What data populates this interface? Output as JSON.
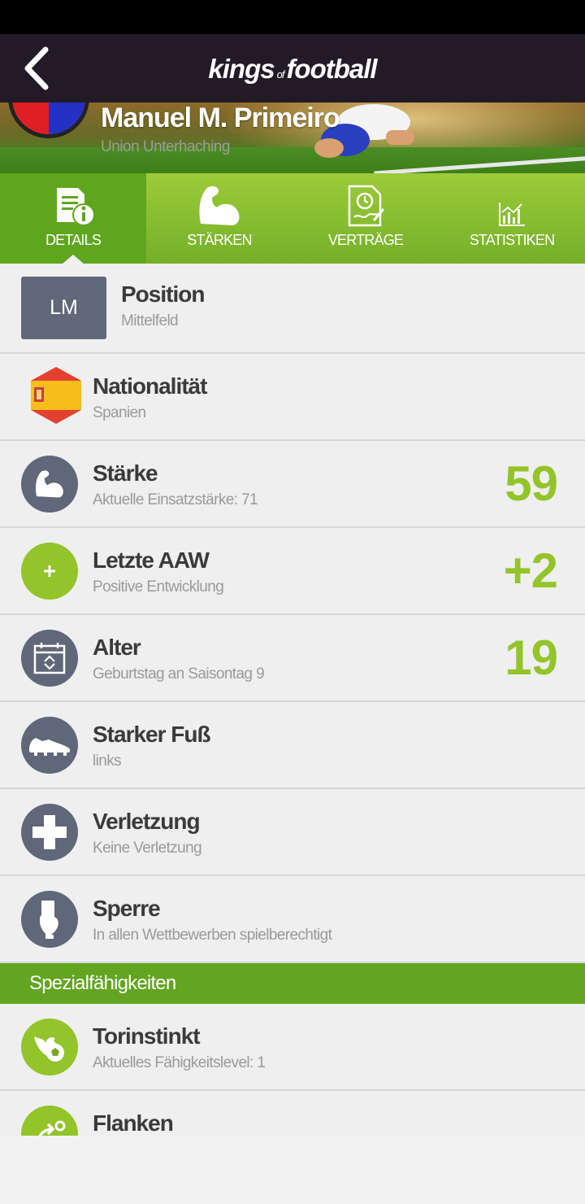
{
  "header": {
    "logo_part1": "kings",
    "logo_of": "of",
    "logo_part2": "football"
  },
  "player": {
    "name": "Manuel M. Primeiro",
    "club": "Union Unterhaching",
    "club_colors": [
      "#e01e26",
      "#2431c4"
    ]
  },
  "tabs": [
    {
      "label": "DETAILS",
      "icon": "details-icon",
      "active": true
    },
    {
      "label": "STÄRKEN",
      "icon": "muscle-icon",
      "active": false
    },
    {
      "label": "VERTRÄGE",
      "icon": "contract-icon",
      "active": false
    },
    {
      "label": "STATISTIKEN",
      "icon": "chart-icon",
      "active": false
    }
  ],
  "details": {
    "position": {
      "badge": "LM",
      "title": "Position",
      "subtitle": "Mittelfeld"
    },
    "nationality": {
      "title": "Nationalität",
      "subtitle": "Spanien",
      "icon": "spain-flag-icon"
    },
    "strength": {
      "title": "Stärke",
      "subtitle": "Aktuelle Einsatzstärke: 71",
      "value": "59",
      "icon": "muscle-icon"
    },
    "last_aaw": {
      "title": "Letzte AAW",
      "subtitle": "Positive Entwicklung",
      "value": "+2",
      "icon": "plus-icon"
    },
    "age": {
      "title": "Alter",
      "subtitle": "Geburtstag an Saisontag 9",
      "value": "19",
      "icon": "calendar-icon"
    },
    "strong_foot": {
      "title": "Starker Fuß",
      "subtitle": "links",
      "icon": "boot-icon"
    },
    "injury": {
      "title": "Verletzung",
      "subtitle": "Keine Verletzung",
      "icon": "medical-cross-icon"
    },
    "suspension": {
      "title": "Sperre",
      "subtitle": "In allen Wettbewerben spielberechtigt",
      "icon": "referee-card-icon"
    }
  },
  "special_section": {
    "header": "Spezialfähigkeiten",
    "items": [
      {
        "title": "Torinstinkt",
        "subtitle": "Aktuelles Fähigkeitslevel: 1",
        "icon": "fire-ball-icon"
      },
      {
        "title": "Flanken",
        "subtitle": "",
        "icon": "cross-arrow-icon"
      }
    ]
  },
  "colors": {
    "accent_green": "#93c42a",
    "tab_active": "#5fa61f",
    "icon_gray": "#5f6779",
    "header_dark": "#221b27"
  }
}
